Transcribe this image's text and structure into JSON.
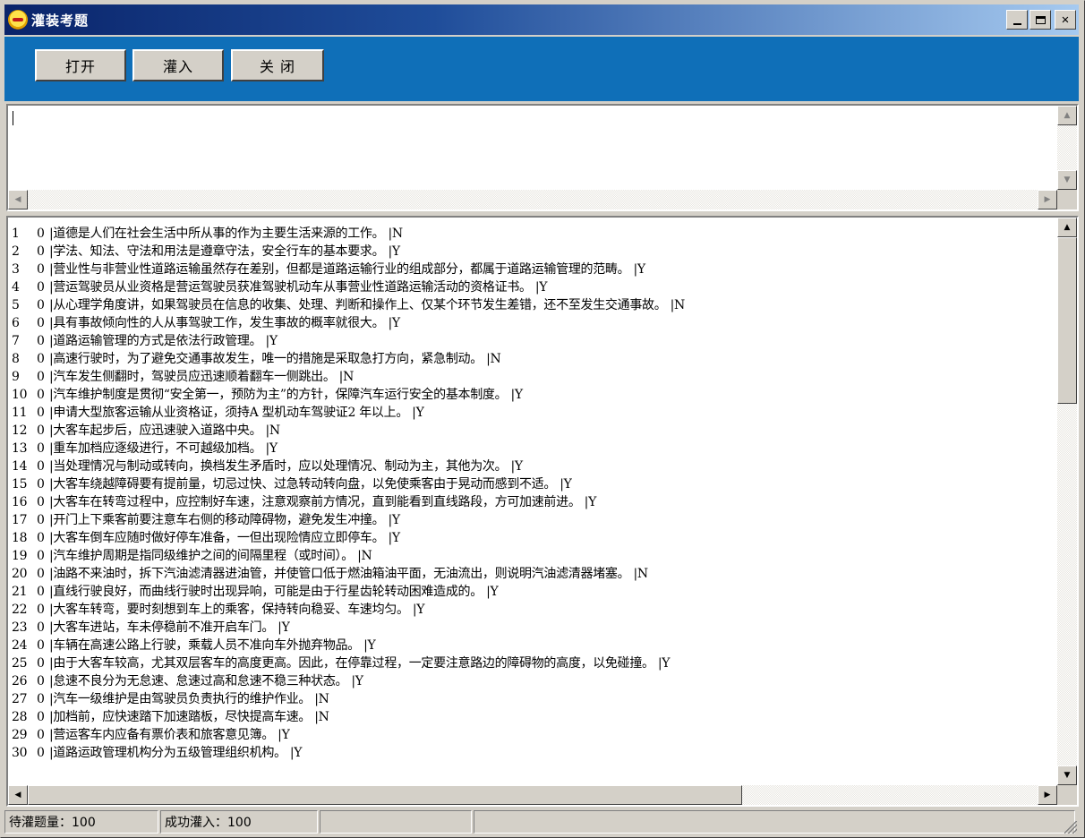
{
  "window": {
    "title": "灌装考题",
    "colors": {
      "title_start": "#0a246a",
      "title_end": "#a6caf0",
      "toolbar": "#0f6fb8",
      "face": "#d4d0c8"
    }
  },
  "title_controls": {
    "minimize": "minimize-icon",
    "maximize": "maximize-icon",
    "close": "close-icon"
  },
  "toolbar": {
    "open_label": "打开",
    "import_label": "灌入",
    "close_label": "关 闭"
  },
  "editor": {
    "value": ""
  },
  "questions": [
    {
      "num": "1",
      "flag": "0",
      "text": "|道德是人们在社会生活中所从事的作为主要生活来源的工作。 |N"
    },
    {
      "num": "2",
      "flag": "0",
      "text": "|学法、知法、守法和用法是遵章守法，安全行车的基本要求。 |Y"
    },
    {
      "num": "3",
      "flag": "0",
      "text": "|营业性与非营业性道路运输虽然存在差别，但都是道路运输行业的组成部分，都属于道路运输管理的范畴。 |Y"
    },
    {
      "num": "4",
      "flag": "0",
      "text": "|营运驾驶员从业资格是营运驾驶员获准驾驶机动车从事营业性道路运输活动的资格证书。 |Y"
    },
    {
      "num": "5",
      "flag": "0",
      "text": "|从心理学角度讲，如果驾驶员在信息的收集、处理、判断和操作上、仅某个环节发生差错，还不至发生交通事故。 |N"
    },
    {
      "num": "6",
      "flag": "0",
      "text": "|具有事故倾向性的人从事驾驶工作，发生事故的概率就很大。 |Y"
    },
    {
      "num": "7",
      "flag": "0",
      "text": "|道路运输管理的方式是依法行政管理。 |Y"
    },
    {
      "num": "8",
      "flag": "0",
      "text": "|高速行驶时，为了避免交通事故发生，唯一的措施是采取急打方向，紧急制动。 |N"
    },
    {
      "num": "9",
      "flag": "0",
      "text": "|汽车发生侧翻时，驾驶员应迅速顺着翻车一侧跳出。 |N"
    },
    {
      "num": "10",
      "flag": "0",
      "text": "|汽车维护制度是贯彻“安全第一，预防为主”的方针，保障汽车运行安全的基本制度。 |Y"
    },
    {
      "num": "11",
      "flag": "0",
      "text": "|申请大型旅客运输从业资格证，须持A 型机动车驾驶证2 年以上。 |Y"
    },
    {
      "num": "12",
      "flag": "0",
      "text": "|大客车起步后，应迅速驶入道路中央。 |N"
    },
    {
      "num": "13",
      "flag": "0",
      "text": "|重车加档应逐级进行，不可越级加档。 |Y"
    },
    {
      "num": "14",
      "flag": "0",
      "text": "|当处理情况与制动或转向，换档发生矛盾时，应以处理情况、制动为主，其他为次。 |Y"
    },
    {
      "num": "15",
      "flag": "0",
      "text": "|大客车绕越障碍要有提前量，切忌过快、过急转动转向盘，以免使乘客由于晃动而感到不适。 |Y"
    },
    {
      "num": "16",
      "flag": "0",
      "text": "|大客车在转弯过程中，应控制好车速，注意观察前方情况，直到能看到直线路段，方可加速前进。 |Y"
    },
    {
      "num": "17",
      "flag": "0",
      "text": "|开门上下乘客前要注意车右侧的移动障碍物，避免发生冲撞。 |Y"
    },
    {
      "num": "18",
      "flag": "0",
      "text": "|大客车倒车应随时做好停车准备，一但出现险情应立即停车。 |Y"
    },
    {
      "num": "19",
      "flag": "0",
      "text": "|汽车维护周期是指同级维护之间的间隔里程（或时间）。 |N"
    },
    {
      "num": "20",
      "flag": "0",
      "text": "|油路不来油时，拆下汽油滤清器进油管，并使管口低于燃油箱油平面，无油流出，则说明汽油滤清器堵塞。 |N"
    },
    {
      "num": "21",
      "flag": "0",
      "text": "|直线行驶良好，而曲线行驶时出现异响，可能是由于行星齿轮转动困难造成的。 |Y"
    },
    {
      "num": "22",
      "flag": "0",
      "text": "|大客车转弯，要时刻想到车上的乘客，保持转向稳妥、车速均匀。 |Y"
    },
    {
      "num": "23",
      "flag": "0",
      "text": "|大客车进站，车未停稳前不准开启车门。 |Y"
    },
    {
      "num": "24",
      "flag": "0",
      "text": "|车辆在高速公路上行驶，乘载人员不准向车外抛弃物品。 |Y"
    },
    {
      "num": "25",
      "flag": "0",
      "text": "|由于大客车较高，尤其双层客车的高度更高。因此，在停靠过程，一定要注意路边的障碍物的高度，以免碰撞。 |Y"
    },
    {
      "num": "26",
      "flag": "0",
      "text": "|怠速不良分为无怠速、怠速过高和怠速不稳三种状态。 |Y"
    },
    {
      "num": "27",
      "flag": "0",
      "text": "|汽车一级维护是由驾驶员负责执行的维护作业。 |N"
    },
    {
      "num": "28",
      "flag": "0",
      "text": "|加档前，应快速踏下加速踏板，尽快提高车速。 |N"
    },
    {
      "num": "29",
      "flag": "0",
      "text": "|营运客车内应备有票价表和旅客意见簿。 |Y"
    },
    {
      "num": "30",
      "flag": "0",
      "text": "|道路运政管理机构分为五级管理组织机构。 |Y"
    }
  ],
  "status": {
    "pending": "待灌题量：100",
    "success": "成功灌入：100",
    "panel3": "",
    "panel4": ""
  }
}
